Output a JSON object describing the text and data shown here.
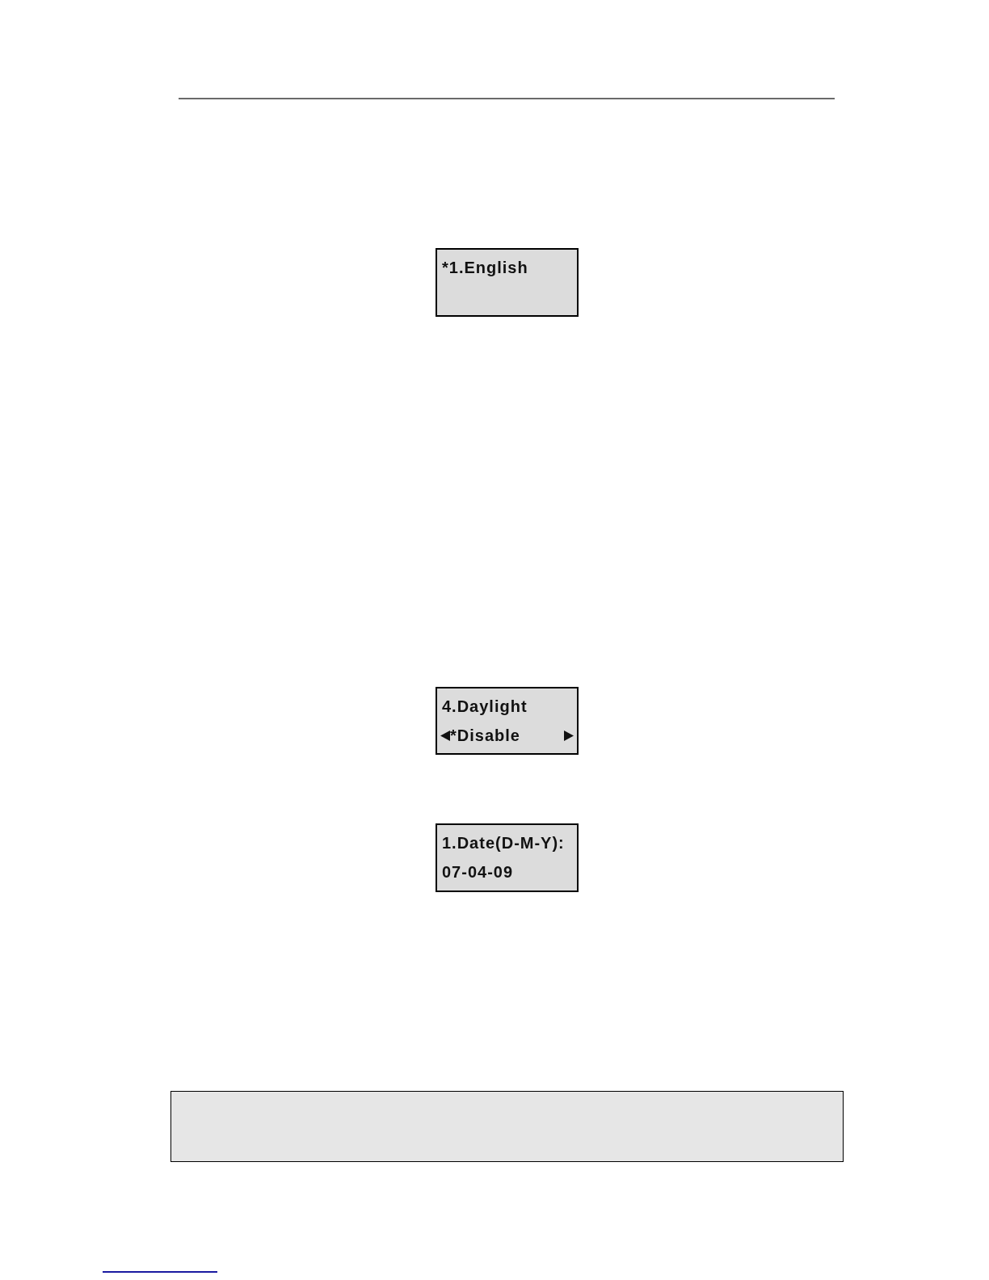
{
  "screens": [
    {
      "lines": [
        {
          "kind": "text",
          "text": "*1.English"
        }
      ]
    },
    {
      "lines": [
        {
          "kind": "text",
          "text": "4.Daylight"
        },
        {
          "kind": "option",
          "text": "*Disable"
        }
      ]
    },
    {
      "lines": [
        {
          "kind": "text",
          "text": "1.Date(D-M-Y):"
        },
        {
          "kind": "text",
          "text": "07-04-09"
        }
      ]
    }
  ]
}
